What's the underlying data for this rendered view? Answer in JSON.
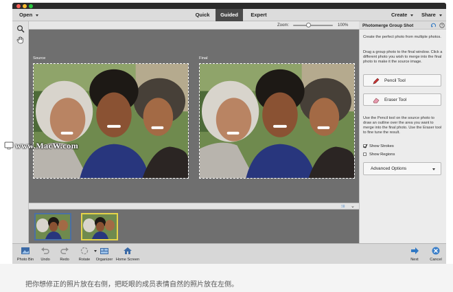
{
  "window": {
    "traffic_lights": [
      "#fe5f57",
      "#febc2e",
      "#28c840"
    ]
  },
  "topnav": {
    "open_label": "Open",
    "tabs": [
      {
        "label": "Quick"
      },
      {
        "label": "Guided"
      },
      {
        "label": "Expert"
      }
    ],
    "active_tab": "Guided",
    "create_label": "Create",
    "share_label": "Share"
  },
  "tools": [
    {
      "icon": "zoom-icon"
    },
    {
      "icon": "hand-icon"
    }
  ],
  "zoom": {
    "label": "Zoom:",
    "value": "100%",
    "level_percent": 38
  },
  "canvas": {
    "source_label": "Source",
    "final_label": "Final"
  },
  "filmstrip": {
    "thumbnails": [
      {
        "state": "selected-source",
        "border": "#4a6fa5"
      },
      {
        "state": "final",
        "border": "#e6d44a"
      }
    ]
  },
  "panel": {
    "title": "Photomerge Group Shot",
    "intro": "Create the perfect photo from multiple photos.",
    "instructions": "Drag a group photo to the final window. Click a different photo you wish to merge into the final photo to make it the source image.",
    "pencil_tool": "Pencil Tool",
    "eraser_tool": "Eraser Tool",
    "pencil_help": "Use the Pencil tool on the source photo to draw an outline over the area you want to merge into the final photo. Use the Eraser tool to fine tune the result.",
    "show_strokes": {
      "label": "Show Strokes",
      "checked": true
    },
    "show_regions": {
      "label": "Show Regions",
      "checked": false
    },
    "advanced_options": "Advanced Options"
  },
  "bottombar": {
    "left_buttons": [
      {
        "label": "Photo Bin",
        "icon": "photo-bin-icon"
      },
      {
        "label": "Undo",
        "icon": "undo-icon"
      },
      {
        "label": "Redo",
        "icon": "redo-icon"
      },
      {
        "label": "Rotate",
        "icon": "rotate-icon"
      },
      {
        "label": "Organizer",
        "icon": "organizer-icon"
      },
      {
        "label": "Home Screen",
        "icon": "home-icon"
      }
    ],
    "next_label": "Next",
    "cancel_label": "Cancel"
  },
  "caption": "把你想修正的照片放在右侧，把眨眼的成员表情自然的照片放在左侧。",
  "watermark": "www.MacW.com",
  "colors": {
    "accent_blue": "#2f78c4",
    "cancel_blue": "#3b7fc9",
    "active_tab_bg": "#4a4a4a"
  }
}
